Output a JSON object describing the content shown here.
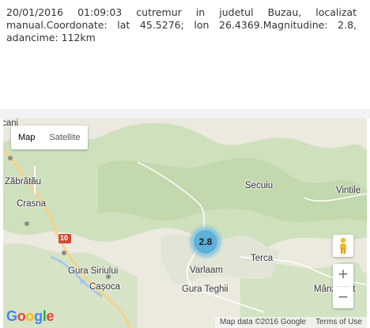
{
  "info": {
    "text": "20/01/2016 01:09:03 cutremur in judetul Buzau, localizat manual.Coordonate: lat 45.5276; lon 26.4369.Magnitudine: 2.8, adancime: 112km"
  },
  "map": {
    "type_control": {
      "map_label": "Map",
      "satellite_label": "Satellite"
    },
    "places": {
      "canii": "cani",
      "zabratau": "Zăbrătău",
      "crasna": "Crasna",
      "road_number": "10",
      "gura_siriului": "Gura Siriului",
      "casoca": "Cașoca",
      "secuiu": "Secuiu",
      "vintile": "Vintile",
      "terca": "Terca",
      "varlaam": "Varlaam",
      "gura_teghii": "Gura Teghii",
      "manzalesti": "Mânzăleșt"
    },
    "marker": {
      "value": "2.8",
      "color": "#5fb0d8"
    },
    "zoom": {
      "in": "+",
      "out": "−"
    },
    "logo": "Google",
    "footer": {
      "data": "Map data ©2016 Google",
      "terms": "Terms of Use"
    }
  }
}
